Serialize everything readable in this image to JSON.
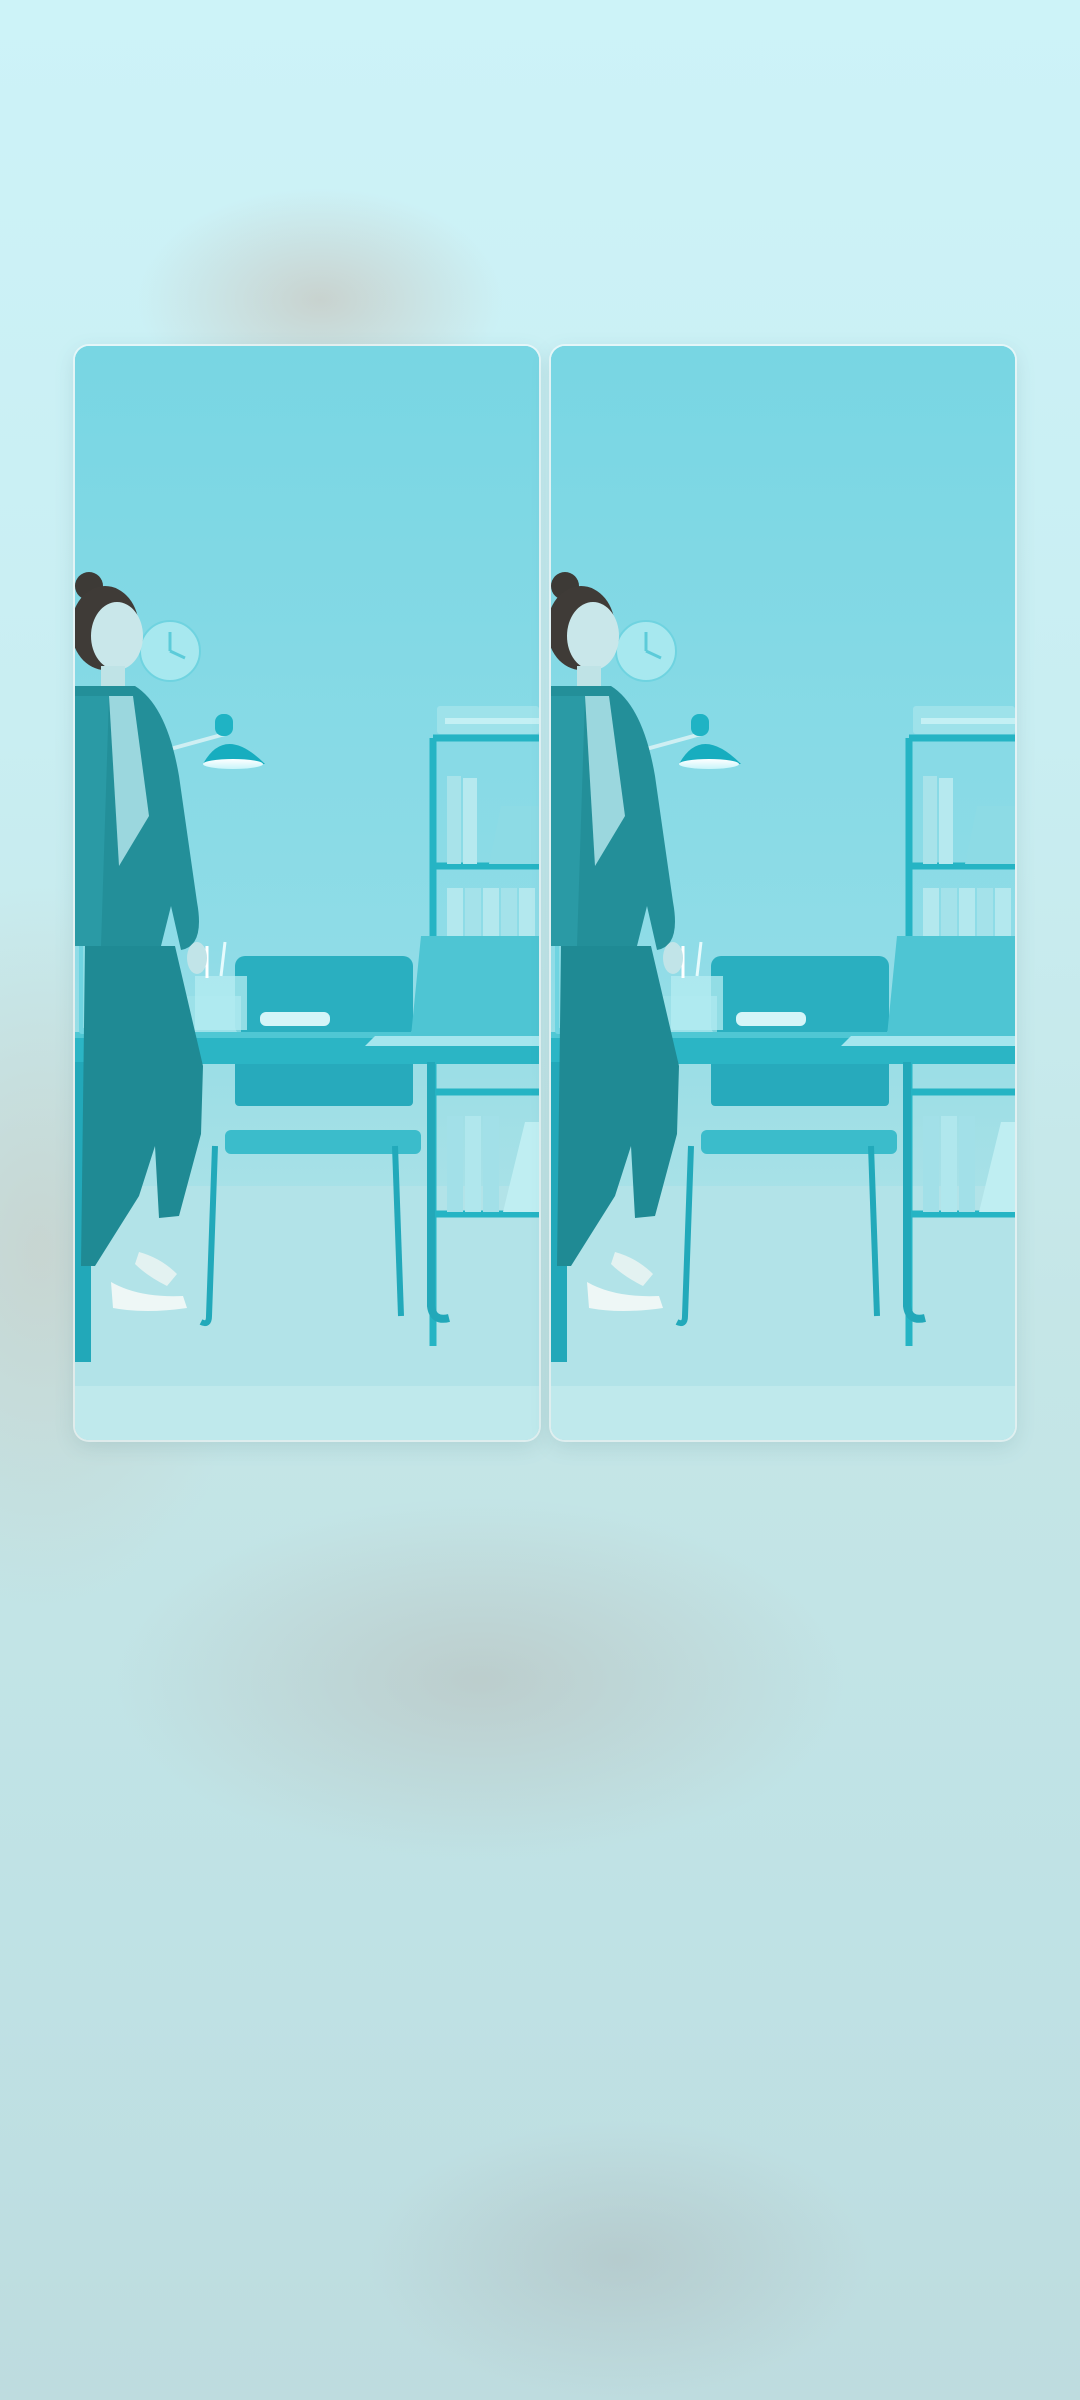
{
  "screen": {
    "type": "app-switcher-split-view",
    "panes": [
      {
        "id": "left",
        "icon": "office-scene-image"
      },
      {
        "id": "right",
        "icon": "office-scene-image"
      }
    ]
  },
  "colors": {
    "background_top": "#cdf3f8",
    "background_bottom": "#bedcdf",
    "scene_wall": "#7ad7e4",
    "scene_furniture": "#2fb6c4",
    "scene_floor": "#b9e6ea"
  }
}
